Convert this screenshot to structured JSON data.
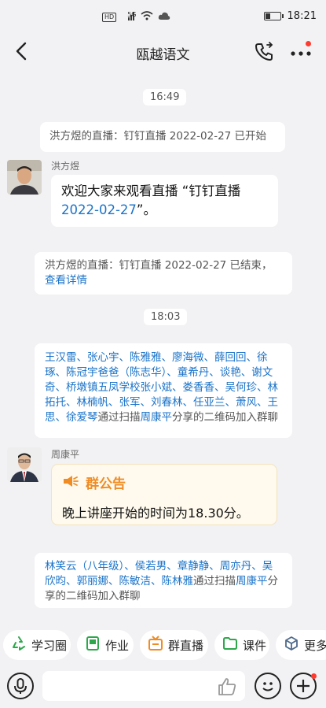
{
  "status_bar": {
    "network_badge": "HD",
    "signal_label": "5G",
    "time": "18:21"
  },
  "header": {
    "title": "瓯越语文"
  },
  "messages": {
    "time_1": "16:49",
    "live_started": "洪方煜的直播：钉钉直播 2022-02-27 已开始",
    "msg1": {
      "sender": "洪方煜",
      "text_prefix": "欢迎大家来观看直播 “钉钉直播",
      "text_link": "2022-02-27",
      "text_suffix": "”。"
    },
    "live_ended": {
      "text": "洪方煜的直播：钉钉直播 2022-02-27 已结束，",
      "link": "查看详情"
    },
    "time_2": "18:03",
    "join1": {
      "names": "王汉雷、张心宇、陈雅雅、廖海微、薛回回、徐琢、陈冠宇爸爸（陈志华）、童希丹、谈艳、谢文奇、桥墩镇五凤学校张小斌、娄香香、吴何珍、林拓托、林楠帆、张军、刘春林、任亚兰、萧风、王思、徐爱琴",
      "mid": "通过扫描",
      "sharer": "周康平",
      "end": "分享的二维码加入群聊"
    },
    "msg2": {
      "sender": "周康平",
      "notice_title": "群公告",
      "notice_text": "晚上讲座开始的时间为18.30分。"
    },
    "join2": {
      "names": "林笑云（八年级）、侯若男、章静静、周亦丹、吴欣昀、郭丽娜、陈敏洁、陈林雅",
      "mid": "通过扫描",
      "sharer": "周康平",
      "end": "分享的二维码加入群聊"
    }
  },
  "toolbar": {
    "chips": [
      "学习圈",
      "作业",
      "群直播",
      "课件",
      "更多"
    ]
  },
  "colors": {
    "link_blue": "#1a73c9",
    "notice_orange": "#f08c24",
    "badge_red": "#ff3b30"
  }
}
